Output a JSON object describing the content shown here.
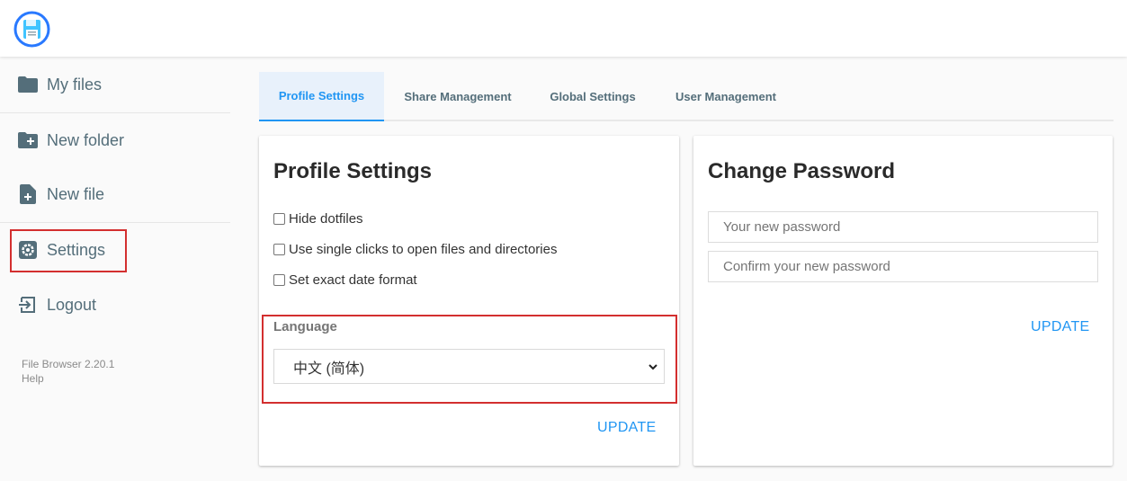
{
  "app": {
    "logo_icon": "floppy-disk-icon",
    "accent_color": "#2196f3"
  },
  "sidebar": {
    "items": [
      {
        "label": "My files",
        "icon": "folder-icon"
      },
      {
        "label": "New folder",
        "icon": "new-folder-icon"
      },
      {
        "label": "New file",
        "icon": "new-file-icon"
      },
      {
        "label": "Settings",
        "icon": "gear-icon"
      },
      {
        "label": "Logout",
        "icon": "logout-icon"
      }
    ],
    "version": "File Browser 2.20.1",
    "help": "Help"
  },
  "tabs": [
    {
      "label": "Profile Settings",
      "active": true
    },
    {
      "label": "Share Management",
      "active": false
    },
    {
      "label": "Global Settings",
      "active": false
    },
    {
      "label": "User Management",
      "active": false
    }
  ],
  "profile": {
    "title": "Profile Settings",
    "options": [
      {
        "label": "Hide dotfiles",
        "checked": false
      },
      {
        "label": "Use single clicks to open files and directories",
        "checked": false
      },
      {
        "label": "Set exact date format",
        "checked": false
      }
    ],
    "language_label": "Language",
    "language_value": "中文 (简体)",
    "update_label": "UPDATE"
  },
  "password": {
    "title": "Change Password",
    "new_placeholder": "Your new password",
    "confirm_placeholder": "Confirm your new password",
    "update_label": "UPDATE"
  },
  "highlight_color": "#d32f2f"
}
